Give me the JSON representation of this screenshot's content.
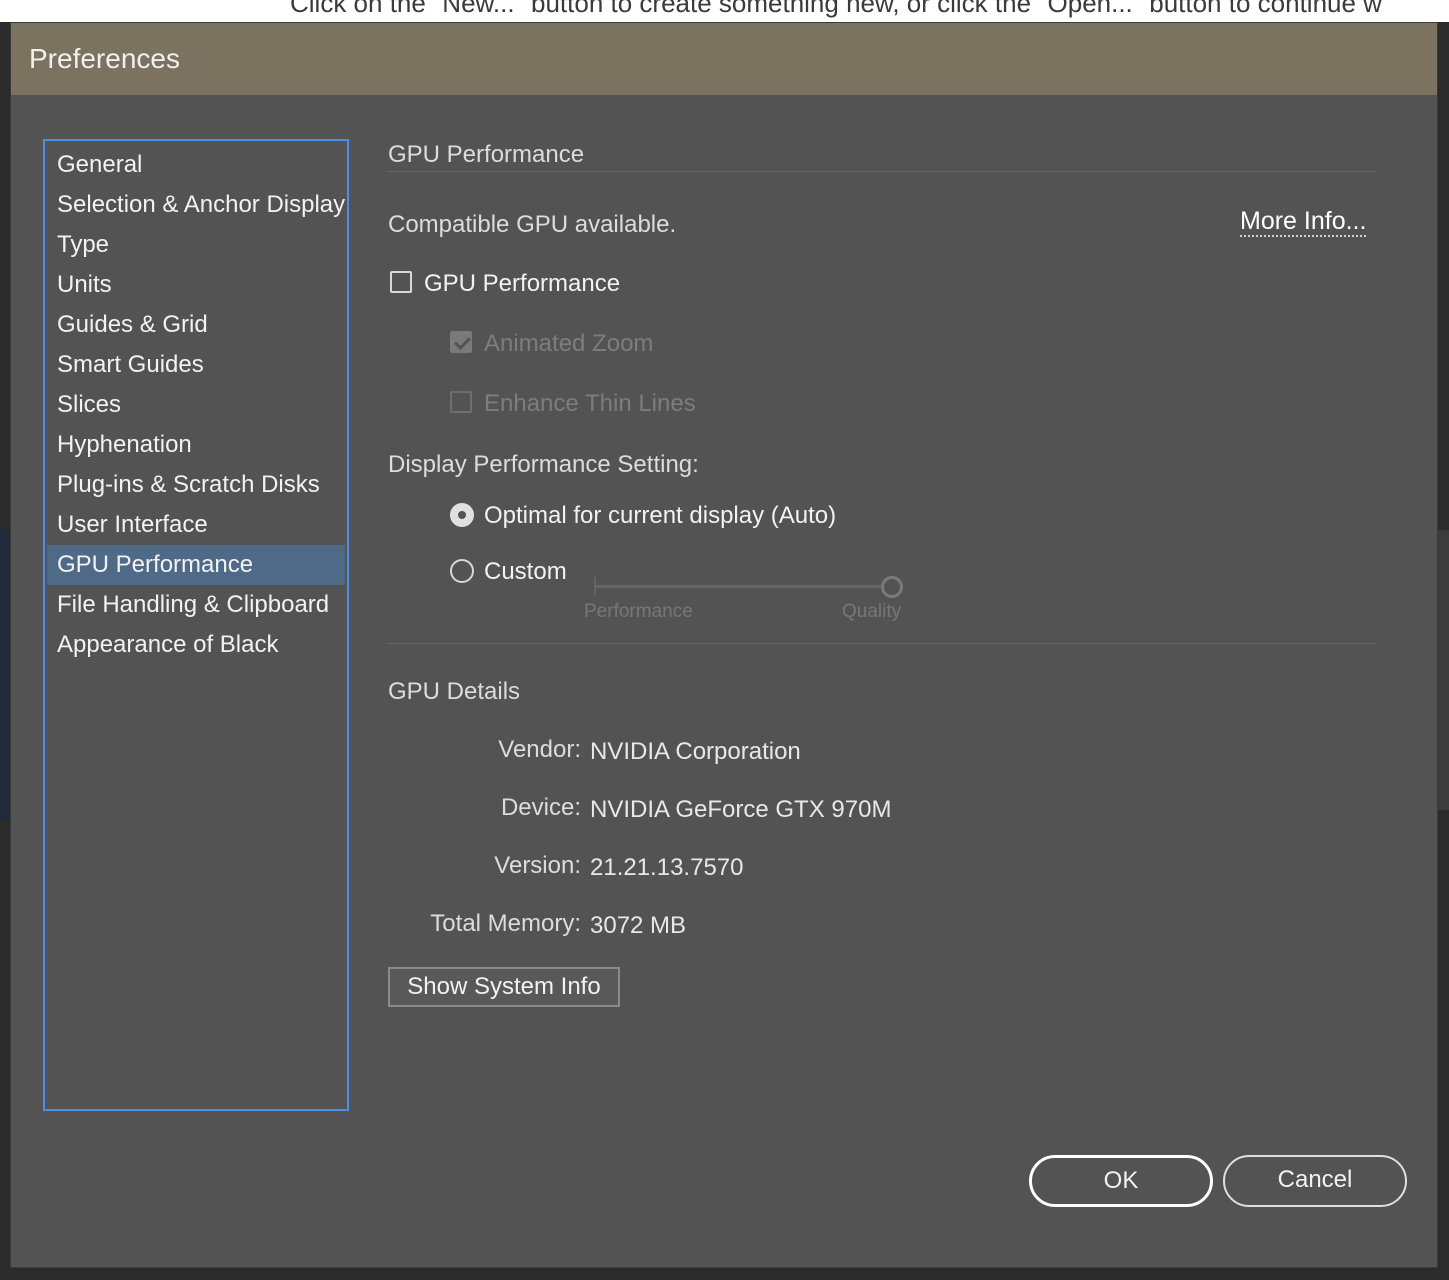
{
  "background": {
    "top_text": "Click on the \"New...\" button to create something new, or click the \"Open...\" button to continue w"
  },
  "dialog": {
    "title": "Preferences"
  },
  "sidebar": {
    "items": [
      {
        "label": "General"
      },
      {
        "label": "Selection & Anchor Display"
      },
      {
        "label": "Type"
      },
      {
        "label": "Units"
      },
      {
        "label": "Guides & Grid"
      },
      {
        "label": "Smart Guides"
      },
      {
        "label": "Slices"
      },
      {
        "label": "Hyphenation"
      },
      {
        "label": "Plug-ins & Scratch Disks"
      },
      {
        "label": "User Interface"
      },
      {
        "label": "GPU Performance",
        "selected": true
      },
      {
        "label": "File Handling & Clipboard"
      },
      {
        "label": "Appearance of Black"
      }
    ]
  },
  "gpu": {
    "section_title": "GPU Performance",
    "compatible_text": "Compatible GPU available.",
    "more_info": "More Info...",
    "gpu_perf_checkbox": {
      "label": "GPU Performance",
      "checked": false
    },
    "animated_zoom": {
      "label": "Animated Zoom",
      "checked": true,
      "enabled": false
    },
    "enhance_thin_lines": {
      "label": "Enhance Thin Lines",
      "checked": false,
      "enabled": false
    },
    "display_setting_label": "Display Performance Setting:",
    "radio_auto": {
      "label": "Optimal for current display (Auto)",
      "selected": true
    },
    "radio_custom": {
      "label": "Custom",
      "selected": false
    },
    "slider": {
      "left_label": "Performance",
      "right_label": "Quality",
      "value": 1.0
    }
  },
  "details": {
    "section_title": "GPU Details",
    "rows": [
      {
        "label": "Vendor:",
        "value": "NVIDIA Corporation"
      },
      {
        "label": "Device:",
        "value": "NVIDIA GeForce GTX 970M"
      },
      {
        "label": "Version:",
        "value": "21.21.13.7570"
      },
      {
        "label": "Total Memory:",
        "value": "3072 MB"
      }
    ],
    "show_system_info": "Show System Info"
  },
  "buttons": {
    "ok": "OK",
    "cancel": "Cancel"
  },
  "colors": {
    "titlebar": "#7b7260",
    "dialog_bg": "#535353",
    "sidebar_border": "#4a90e2",
    "selected_item": "#4f6a86"
  }
}
